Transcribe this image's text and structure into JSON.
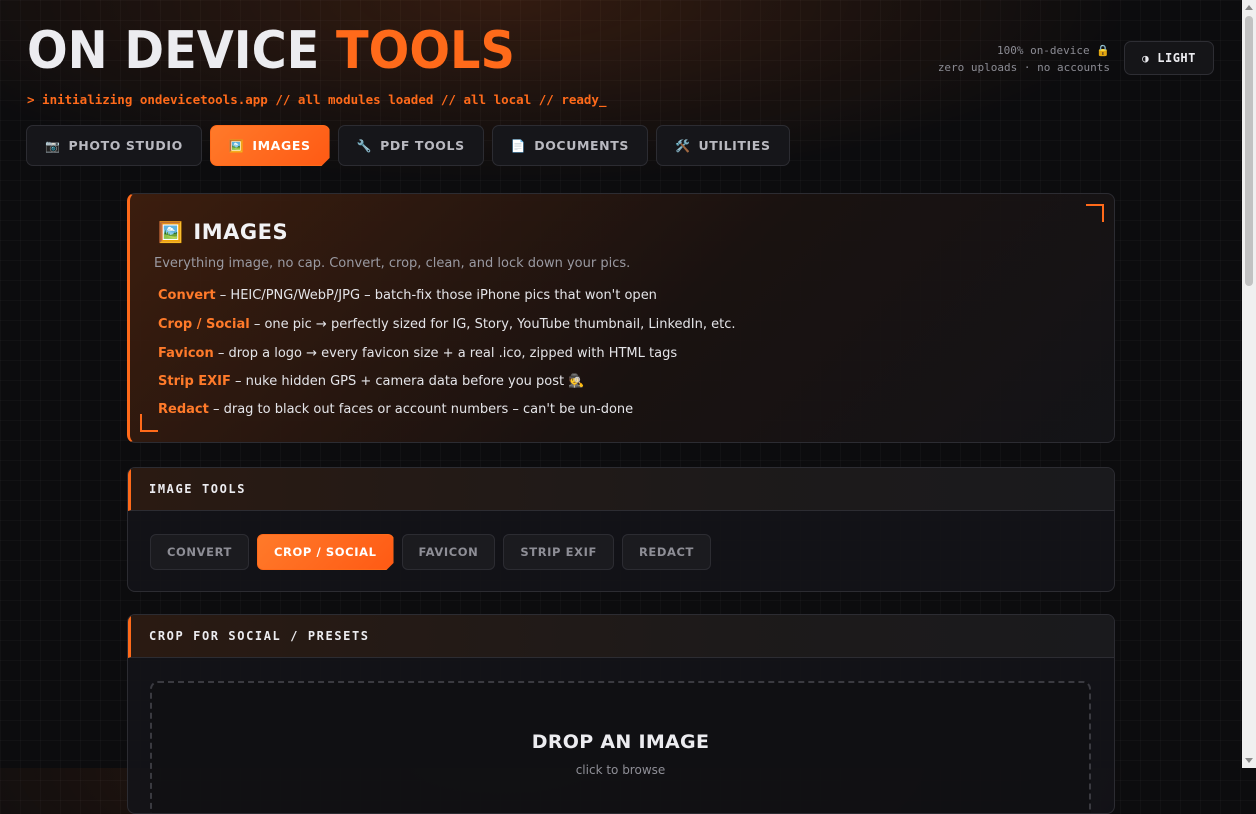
{
  "header": {
    "brand_part1": "ON DEVICE ",
    "brand_part2": "TOOLS",
    "terminal_line": "> initializing ondevicetools.app // all modules loaded // all local // ready_",
    "status_line1": "100% on-device 🔒",
    "status_line2": "zero uploads · no accounts",
    "theme_icon": "◑",
    "theme_label": "LIGHT"
  },
  "nav": {
    "tabs": [
      {
        "icon": "📷",
        "label": "PHOTO STUDIO"
      },
      {
        "icon": "🖼️",
        "label": "IMAGES"
      },
      {
        "icon": "🔧",
        "label": "PDF TOOLS"
      },
      {
        "icon": "📄",
        "label": "DOCUMENTS"
      },
      {
        "icon": "🛠️",
        "label": "UTILITIES"
      }
    ],
    "active": "IMAGES"
  },
  "hero": {
    "icon": "🖼️",
    "title": "IMAGES",
    "subtitle": "Everything image, no cap. Convert, crop, clean, and lock down your pics.",
    "features": [
      {
        "name": "Convert",
        "desc": " – HEIC/PNG/WebP/JPG – batch-fix those iPhone pics that won't open"
      },
      {
        "name": "Crop / Social",
        "desc": " – one pic → perfectly sized for IG, Story, YouTube thumbnail, LinkedIn, etc."
      },
      {
        "name": "Favicon",
        "desc": " – drop a logo → every favicon size + a real .ico, zipped with HTML tags"
      },
      {
        "name": "Strip EXIF",
        "desc": " – nuke hidden GPS + camera data before you post 🕵️"
      },
      {
        "name": "Redact",
        "desc": " – drag to black out faces or account numbers – can't be un-done"
      }
    ]
  },
  "image_tools": {
    "heading": "IMAGE TOOLS",
    "tabs": [
      "CONVERT",
      "CROP / SOCIAL",
      "FAVICON",
      "STRIP EXIF",
      "REDACT"
    ],
    "active": "CROP / SOCIAL"
  },
  "crop": {
    "heading": "CROP FOR SOCIAL / PRESETS",
    "drop_title": "DROP AN IMAGE",
    "drop_sub": "click to browse"
  },
  "colors": {
    "accent": "#ff6a1a",
    "background": "#0c0c0e",
    "card": "#141418",
    "text": "#ececf0",
    "muted": "#8e8e96"
  }
}
